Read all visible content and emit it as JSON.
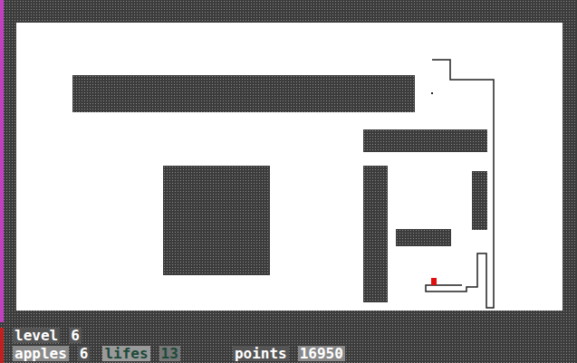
{
  "hud": {
    "level": {
      "label": "level",
      "value": "6"
    },
    "apples": {
      "label": "apples",
      "value": "6"
    },
    "lifes": {
      "label": "lifes",
      "value": "13"
    },
    "points": {
      "label": "points",
      "value": "16950"
    }
  }
}
